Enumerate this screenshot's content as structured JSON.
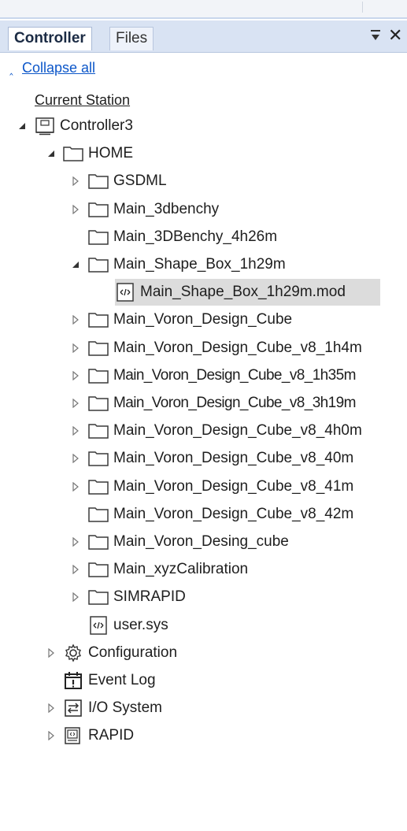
{
  "panel": {
    "tabs": [
      {
        "label": "Controller",
        "active": true
      },
      {
        "label": "Files",
        "active": false
      }
    ],
    "pin_glyph": "⊽",
    "close_glyph": "✕",
    "collapse_all": "Collapse all",
    "current_station": "Current Station"
  },
  "tree": [
    {
      "label": "Controller3",
      "level": 0,
      "icon": "controller-icon",
      "expander": "expanded"
    },
    {
      "label": "HOME",
      "level": 1,
      "icon": "folder-icon",
      "expander": "expanded"
    },
    {
      "label": "GSDML",
      "level": 2,
      "icon": "folder-icon",
      "expander": "collapsed"
    },
    {
      "label": "Main_3dbenchy",
      "level": 2,
      "icon": "folder-icon",
      "expander": "collapsed"
    },
    {
      "label": "Main_3DBenchy_4h26m",
      "level": 2,
      "icon": "folder-icon",
      "expander": "none"
    },
    {
      "label": "Main_Shape_Box_1h29m",
      "level": 2,
      "icon": "folder-icon",
      "expander": "expanded"
    },
    {
      "label": "Main_Shape_Box_1h29m.mod",
      "level": 3,
      "icon": "module-file-icon",
      "expander": "none",
      "selected": true
    },
    {
      "label": "Main_Voron_Design_Cube",
      "level": 2,
      "icon": "folder-icon",
      "expander": "collapsed"
    },
    {
      "label": "Main_Voron_Design_Cube_v8_1h4m",
      "level": 2,
      "icon": "folder-icon",
      "expander": "collapsed"
    },
    {
      "label": "Main_Voron_Design_Cube_v8_1h35m",
      "level": 2,
      "icon": "folder-icon",
      "expander": "collapsed",
      "narrow": true
    },
    {
      "label": "Main_Voron_Design_Cube_v8_3h19m",
      "level": 2,
      "icon": "folder-icon",
      "expander": "collapsed",
      "narrow": true
    },
    {
      "label": "Main_Voron_Design_Cube_v8_4h0m",
      "level": 2,
      "icon": "folder-icon",
      "expander": "collapsed"
    },
    {
      "label": "Main_Voron_Design_Cube_v8_40m",
      "level": 2,
      "icon": "folder-icon",
      "expander": "collapsed"
    },
    {
      "label": "Main_Voron_Design_Cube_v8_41m",
      "level": 2,
      "icon": "folder-icon",
      "expander": "collapsed"
    },
    {
      "label": "Main_Voron_Design_Cube_v8_42m",
      "level": 2,
      "icon": "folder-icon",
      "expander": "none"
    },
    {
      "label": "Main_Voron_Desing_cube",
      "level": 2,
      "icon": "folder-icon",
      "expander": "collapsed"
    },
    {
      "label": "Main_xyzCalibration",
      "level": 2,
      "icon": "folder-icon",
      "expander": "collapsed"
    },
    {
      "label": "SIMRAPID",
      "level": 2,
      "icon": "folder-icon",
      "expander": "collapsed"
    },
    {
      "label": "user.sys",
      "level": 2,
      "icon": "module-file-icon",
      "expander": "none"
    },
    {
      "label": "Configuration",
      "level": 1,
      "icon": "gear-icon",
      "expander": "collapsed"
    },
    {
      "label": "Event Log",
      "level": 1,
      "icon": "event-log-icon",
      "expander": "none"
    },
    {
      "label": "I/O System",
      "level": 1,
      "icon": "io-system-icon",
      "expander": "collapsed"
    },
    {
      "label": "RAPID",
      "level": 1,
      "icon": "rapid-icon",
      "expander": "collapsed"
    }
  ],
  "colors": {
    "tab_strip": "#d9e3f3",
    "link": "#0d57c9",
    "selection": "#dcdcdc"
  }
}
